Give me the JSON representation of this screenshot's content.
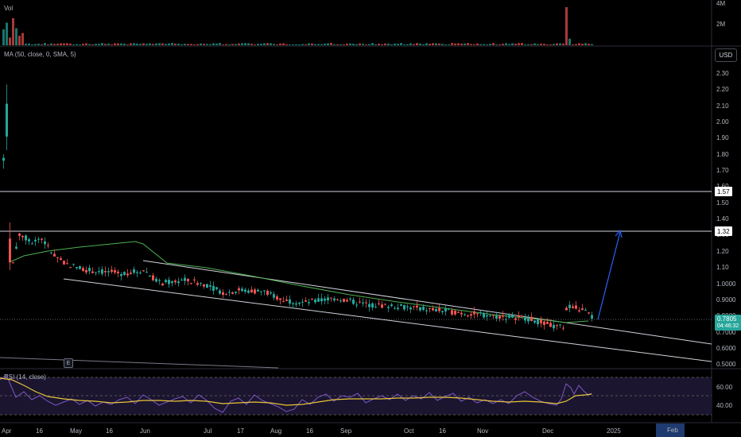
{
  "panes": {
    "volume": {
      "title": "Vol",
      "axis": [
        "4M",
        "2M"
      ]
    },
    "price": {
      "title": "MA (50, close, 0, SMA, 5)",
      "currency": "USD",
      "axis": [
        "2.30",
        "2.20",
        "2.10",
        "2.00",
        "1.90",
        "1.80",
        "1.70",
        "1.60",
        "1.50",
        "1.40",
        "1.30",
        "1.20",
        "1.10",
        "1.0000",
        "0.9000",
        "0.8000",
        "0.7000",
        "0.6000",
        "0.5000"
      ],
      "levels": [
        {
          "label": "1.57",
          "value": 1.57
        },
        {
          "label": "1.32",
          "value": 1.32
        }
      ],
      "last_price": {
        "value": "0.7805",
        "countdown": "04:46:32"
      },
      "event_marker": "E"
    },
    "rsi": {
      "title": "RSI (14, close)",
      "axis": [
        "60.00",
        "40.00"
      ]
    }
  },
  "time_axis": [
    "Apr",
    "16",
    "May",
    "16",
    "Jun",
    "Jul",
    "17",
    "Aug",
    "16",
    "Sep",
    "Oct",
    "16",
    "Nov",
    "Dec",
    "2025",
    "Feb"
  ],
  "colors": {
    "up": "#26a69a",
    "down": "#ef5350",
    "ma": "#4caf50",
    "rsi": "#7e57c2",
    "rsi_ma": "#e8c43a",
    "arrow": "#2962ff",
    "channel": "#d1d4dc"
  },
  "chart_data": {
    "type": "candlestick",
    "ylim": [
      0.48,
      2.33
    ],
    "x": [
      "Apr",
      "Apr",
      "Apr",
      "Apr 16",
      "May",
      "May 16",
      "Jun",
      "Jul",
      "Jul 17",
      "Aug",
      "Aug 16",
      "Sep",
      "Oct",
      "Oct 16",
      "Nov",
      "Dec",
      "Dec"
    ],
    "close": [
      1.85,
      1.05,
      1.35,
      1.22,
      1.08,
      1.07,
      1.06,
      1.0,
      0.96,
      0.92,
      0.89,
      0.87,
      0.83,
      0.8,
      0.77,
      0.71,
      0.78
    ],
    "ma_label": "MA (50, close, 0, SMA, 5)",
    "rsi_label": "RSI (14, close)",
    "rsi_range": [
      20,
      70
    ],
    "rsi_last": 49
  }
}
